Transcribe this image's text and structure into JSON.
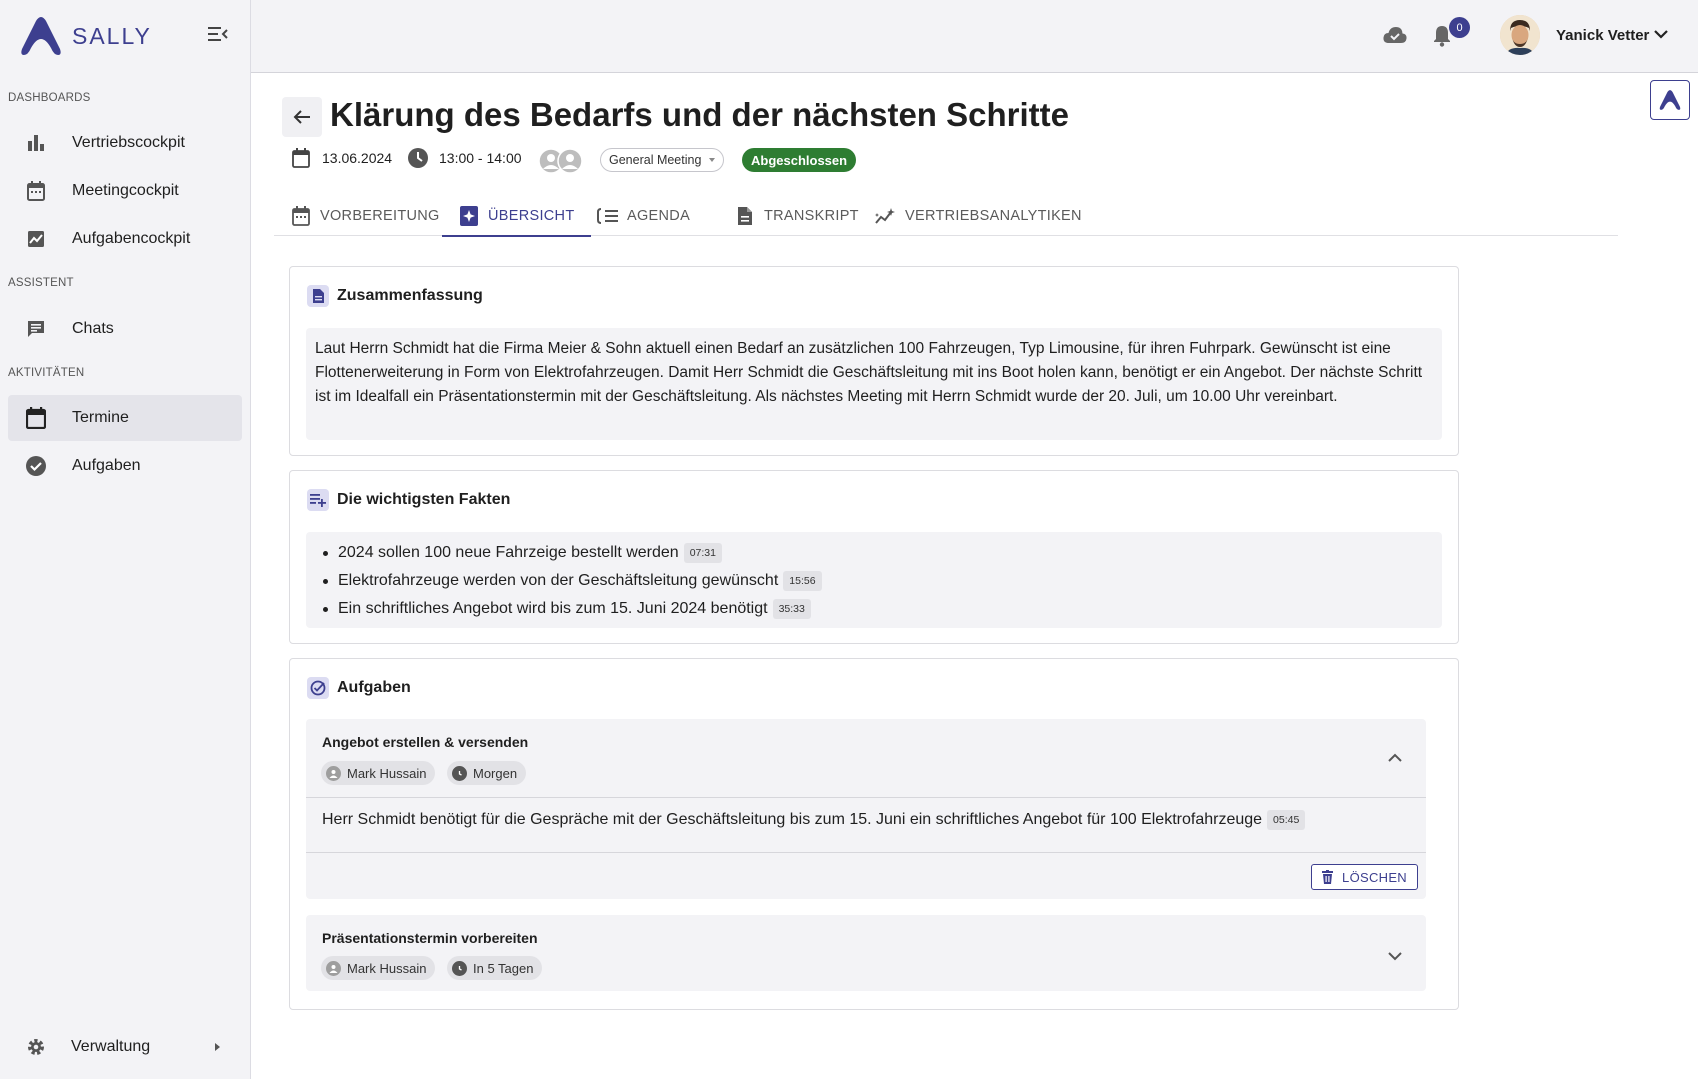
{
  "app": {
    "name": "SALLY",
    "brand_color": "#3d3f8f",
    "success_color": "#2e7d32"
  },
  "sidebar": {
    "sections": [
      {
        "label": "DASHBOARDS",
        "items": [
          {
            "label": "Vertriebscockpit",
            "icon": "bar-chart-icon"
          },
          {
            "label": "Meetingcockpit",
            "icon": "calendar-icon"
          },
          {
            "label": "Aufgabencockpit",
            "icon": "trend-chart-icon"
          }
        ]
      },
      {
        "label": "ASSISTENT",
        "items": [
          {
            "label": "Chats",
            "icon": "chat-icon"
          }
        ]
      },
      {
        "label": "AKTIVITÄTEN",
        "items": [
          {
            "label": "Termine",
            "icon": "calendar-icon",
            "active": true
          },
          {
            "label": "Aufgaben",
            "icon": "check-circle-icon"
          }
        ]
      }
    ],
    "footer": {
      "label": "Verwaltung",
      "icon": "gear-icon"
    }
  },
  "topbar": {
    "notification_count": "0",
    "user_name": "Yanick Vetter"
  },
  "meeting": {
    "title": "Klärung des Bedarfs und der nächsten Schritte",
    "date": "13.06.2024",
    "time": "13:00 - 14:00",
    "type": "General Meeting",
    "status": "Abgeschlossen"
  },
  "tabs": [
    {
      "label": "VORBEREITUNG",
      "icon": "calendar-icon"
    },
    {
      "label": "ÜBERSICHT",
      "icon": "sparkle-icon",
      "active": true
    },
    {
      "label": "AGENDA",
      "icon": "checklist-icon"
    },
    {
      "label": "TRANSKRIPT",
      "icon": "document-icon"
    },
    {
      "label": "VERTRIEBSANALYTIKEN",
      "icon": "analytics-icon"
    }
  ],
  "summary": {
    "title": "Zusammenfassung",
    "text": "Laut Herrn Schmidt hat die Firma Meier & Sohn aktuell einen Bedarf an zusätzlichen 100 Fahrzeugen, Typ Limousine, für ihren Fuhrpark. Gewünscht ist eine Flottenerweiterung in Form von Elektrofahrzeugen. Damit Herr Schmidt die Geschäftsleitung mit ins Boot holen kann, benötigt er ein Angebot. Der nächste Schritt ist im Idealfall ein Präsentationstermin mit der Geschäftsleitung. Als nächstes Meeting mit Herrn Schmidt wurde der 20. Juli, um 10.00 Uhr vereinbart."
  },
  "facts": {
    "title": "Die wichtigsten Fakten",
    "items": [
      {
        "text": "2024 sollen 100 neue Fahrzeige bestellt werden",
        "time": "07:31"
      },
      {
        "text": "Elektrofahrzeuge werden von der Geschäftsleitung gewünscht",
        "time": "15:56"
      },
      {
        "text": "Ein schriftliches Angebot wird bis zum 15. Juni 2024 benötigt",
        "time": "35:33"
      }
    ]
  },
  "tasks": {
    "title": "Aufgaben",
    "items": [
      {
        "title": "Angebot erstellen & versenden",
        "assignee": "Mark Hussain",
        "due": "Morgen",
        "expanded": true,
        "description": "Herr Schmidt benötigt für die Gespräche mit der Geschäftsleitung bis zum 15. Juni ein schriftliches Angebot für 100 Elektrofahrzeuge",
        "time": "05:45",
        "delete_label": "LÖSCHEN"
      },
      {
        "title": "Präsentationstermin vorbereiten",
        "assignee": "Mark Hussain",
        "due": "In 5 Tagen",
        "expanded": false
      }
    ]
  }
}
